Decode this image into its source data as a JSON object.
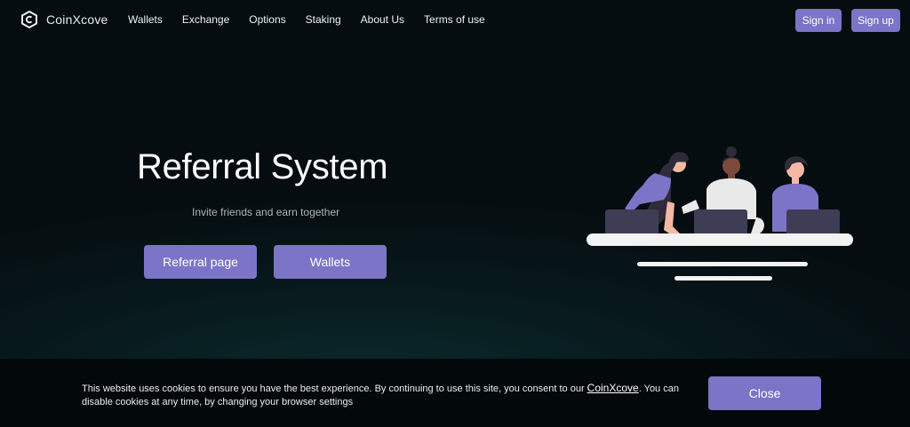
{
  "brand": {
    "name": "CoinXcove",
    "icon": "coinxcove-logo-icon"
  },
  "nav": {
    "links": [
      "Wallets",
      "Exchange",
      "Options",
      "Staking",
      "About Us",
      "Terms of use"
    ],
    "signin_label": "Sign in",
    "signup_label": "Sign up"
  },
  "hero": {
    "title": "Referral System",
    "subtitle": "Invite friends and earn together",
    "primary_button": "Referral page",
    "secondary_button": "Wallets",
    "illustration": "team-working-at-laptops-illustration"
  },
  "cookie": {
    "text_before": "This website uses cookies to ensure you have the best experience. By continuing to use this site, you consent to our ",
    "link_text": "CoinXcove",
    "text_after": ". You can disable cookies at any time, by changing your browser settings",
    "close_label": "Close"
  },
  "colors": {
    "accent": "#7b74c7",
    "background": "#061216",
    "cookie_bar": "#03080a"
  }
}
